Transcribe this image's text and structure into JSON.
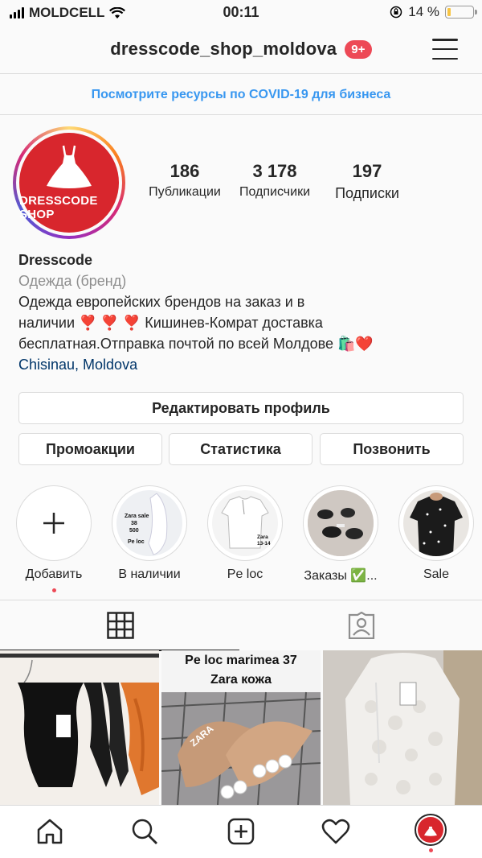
{
  "status_bar": {
    "carrier": "MOLDCELL",
    "time": "00:11",
    "battery_percent": "14 %",
    "battery_level": 0.14,
    "battery_color": "#f7c443"
  },
  "header": {
    "username": "dresscode_shop_moldova",
    "notifications_badge": "9+",
    "menu_icon": "hamburger-menu-icon"
  },
  "banner": {
    "text": "Посмотрите ресурсы по COVID-19 для бизнеса"
  },
  "profile": {
    "avatar_brand": "DRESSCODE SHOP",
    "stats": [
      {
        "value": "186",
        "label": "Публикации"
      },
      {
        "value": "3 178",
        "label": "Подписчики"
      },
      {
        "value": "197",
        "label": "Подписки"
      }
    ],
    "name": "Dresscode",
    "category": "Одежда (бренд)",
    "bio_line1": "Одежда европейских брендов на заказ и в",
    "bio_line2": "наличии ❣️ ❣️ ❣️ Кишинев-Комрат доставка",
    "bio_line3": "бесплатная.Отправка почтой по всей Молдове 🛍️❤️",
    "location": "Chisinau, Moldova"
  },
  "buttons": {
    "edit_profile": "Редактировать профиль",
    "promotions": "Промоакции",
    "statistics": "Статистика",
    "call": "Позвонить"
  },
  "highlights": [
    {
      "label": "Добавить",
      "icon": "plus-icon"
    },
    {
      "label": "В наличии",
      "thumb_text": "Zara sale 38 500\nPe loc"
    },
    {
      "label": "Pe loc",
      "thumb_text": "Zara 13-14"
    },
    {
      "label": "Заказы ✅ ...",
      "display": "Заказы ✅..."
    },
    {
      "label": "Sale"
    }
  ],
  "tabs": {
    "grid_icon": "grid-icon",
    "tagged_icon": "tagged-person-icon"
  },
  "posts": [
    {
      "desc": "black bodysuits on hangers"
    },
    {
      "overlay_line1": "Pe loc marimea 37",
      "overlay_line2": "Zara кожа"
    },
    {
      "desc": "white coat"
    }
  ],
  "bottom_nav": [
    "home-icon",
    "search-icon",
    "new-post-icon",
    "activity-heart-icon",
    "profile-avatar-icon"
  ],
  "colors": {
    "accent_blue": "#3897f0",
    "badge_red": "#ed4956",
    "brand_red": "#d8262d",
    "location_blue": "#003569"
  }
}
